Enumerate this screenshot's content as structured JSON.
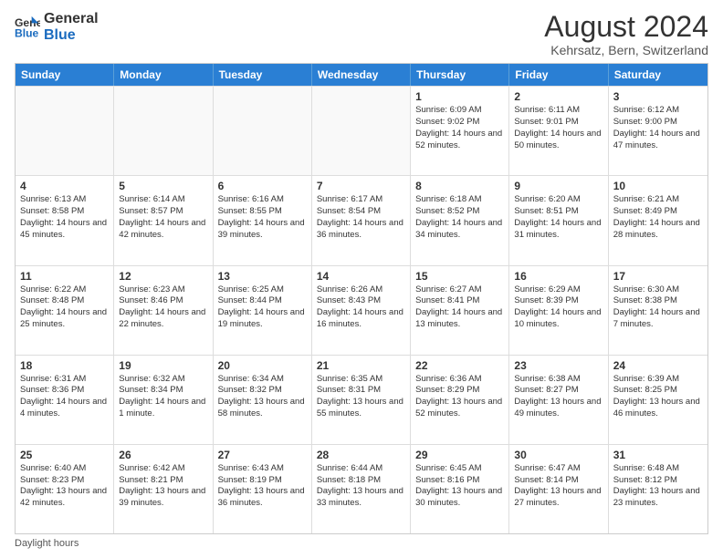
{
  "logo": {
    "line1": "General",
    "line2": "Blue"
  },
  "title": "August 2024",
  "subtitle": "Kehrsatz, Bern, Switzerland",
  "days_of_week": [
    "Sunday",
    "Monday",
    "Tuesday",
    "Wednesday",
    "Thursday",
    "Friday",
    "Saturday"
  ],
  "footer": "Daylight hours",
  "weeks": [
    [
      {
        "day": "",
        "info": "",
        "empty": true
      },
      {
        "day": "",
        "info": "",
        "empty": true
      },
      {
        "day": "",
        "info": "",
        "empty": true
      },
      {
        "day": "",
        "info": "",
        "empty": true
      },
      {
        "day": "1",
        "info": "Sunrise: 6:09 AM\nSunset: 9:02 PM\nDaylight: 14 hours\nand 52 minutes."
      },
      {
        "day": "2",
        "info": "Sunrise: 6:11 AM\nSunset: 9:01 PM\nDaylight: 14 hours\nand 50 minutes."
      },
      {
        "day": "3",
        "info": "Sunrise: 6:12 AM\nSunset: 9:00 PM\nDaylight: 14 hours\nand 47 minutes."
      }
    ],
    [
      {
        "day": "4",
        "info": "Sunrise: 6:13 AM\nSunset: 8:58 PM\nDaylight: 14 hours\nand 45 minutes."
      },
      {
        "day": "5",
        "info": "Sunrise: 6:14 AM\nSunset: 8:57 PM\nDaylight: 14 hours\nand 42 minutes."
      },
      {
        "day": "6",
        "info": "Sunrise: 6:16 AM\nSunset: 8:55 PM\nDaylight: 14 hours\nand 39 minutes."
      },
      {
        "day": "7",
        "info": "Sunrise: 6:17 AM\nSunset: 8:54 PM\nDaylight: 14 hours\nand 36 minutes."
      },
      {
        "day": "8",
        "info": "Sunrise: 6:18 AM\nSunset: 8:52 PM\nDaylight: 14 hours\nand 34 minutes."
      },
      {
        "day": "9",
        "info": "Sunrise: 6:20 AM\nSunset: 8:51 PM\nDaylight: 14 hours\nand 31 minutes."
      },
      {
        "day": "10",
        "info": "Sunrise: 6:21 AM\nSunset: 8:49 PM\nDaylight: 14 hours\nand 28 minutes."
      }
    ],
    [
      {
        "day": "11",
        "info": "Sunrise: 6:22 AM\nSunset: 8:48 PM\nDaylight: 14 hours\nand 25 minutes."
      },
      {
        "day": "12",
        "info": "Sunrise: 6:23 AM\nSunset: 8:46 PM\nDaylight: 14 hours\nand 22 minutes."
      },
      {
        "day": "13",
        "info": "Sunrise: 6:25 AM\nSunset: 8:44 PM\nDaylight: 14 hours\nand 19 minutes."
      },
      {
        "day": "14",
        "info": "Sunrise: 6:26 AM\nSunset: 8:43 PM\nDaylight: 14 hours\nand 16 minutes."
      },
      {
        "day": "15",
        "info": "Sunrise: 6:27 AM\nSunset: 8:41 PM\nDaylight: 14 hours\nand 13 minutes."
      },
      {
        "day": "16",
        "info": "Sunrise: 6:29 AM\nSunset: 8:39 PM\nDaylight: 14 hours\nand 10 minutes."
      },
      {
        "day": "17",
        "info": "Sunrise: 6:30 AM\nSunset: 8:38 PM\nDaylight: 14 hours\nand 7 minutes."
      }
    ],
    [
      {
        "day": "18",
        "info": "Sunrise: 6:31 AM\nSunset: 8:36 PM\nDaylight: 14 hours\nand 4 minutes."
      },
      {
        "day": "19",
        "info": "Sunrise: 6:32 AM\nSunset: 8:34 PM\nDaylight: 14 hours\nand 1 minute."
      },
      {
        "day": "20",
        "info": "Sunrise: 6:34 AM\nSunset: 8:32 PM\nDaylight: 13 hours\nand 58 minutes."
      },
      {
        "day": "21",
        "info": "Sunrise: 6:35 AM\nSunset: 8:31 PM\nDaylight: 13 hours\nand 55 minutes."
      },
      {
        "day": "22",
        "info": "Sunrise: 6:36 AM\nSunset: 8:29 PM\nDaylight: 13 hours\nand 52 minutes."
      },
      {
        "day": "23",
        "info": "Sunrise: 6:38 AM\nSunset: 8:27 PM\nDaylight: 13 hours\nand 49 minutes."
      },
      {
        "day": "24",
        "info": "Sunrise: 6:39 AM\nSunset: 8:25 PM\nDaylight: 13 hours\nand 46 minutes."
      }
    ],
    [
      {
        "day": "25",
        "info": "Sunrise: 6:40 AM\nSunset: 8:23 PM\nDaylight: 13 hours\nand 42 minutes."
      },
      {
        "day": "26",
        "info": "Sunrise: 6:42 AM\nSunset: 8:21 PM\nDaylight: 13 hours\nand 39 minutes."
      },
      {
        "day": "27",
        "info": "Sunrise: 6:43 AM\nSunset: 8:19 PM\nDaylight: 13 hours\nand 36 minutes."
      },
      {
        "day": "28",
        "info": "Sunrise: 6:44 AM\nSunset: 8:18 PM\nDaylight: 13 hours\nand 33 minutes."
      },
      {
        "day": "29",
        "info": "Sunrise: 6:45 AM\nSunset: 8:16 PM\nDaylight: 13 hours\nand 30 minutes."
      },
      {
        "day": "30",
        "info": "Sunrise: 6:47 AM\nSunset: 8:14 PM\nDaylight: 13 hours\nand 27 minutes."
      },
      {
        "day": "31",
        "info": "Sunrise: 6:48 AM\nSunset: 8:12 PM\nDaylight: 13 hours\nand 23 minutes."
      }
    ]
  ]
}
